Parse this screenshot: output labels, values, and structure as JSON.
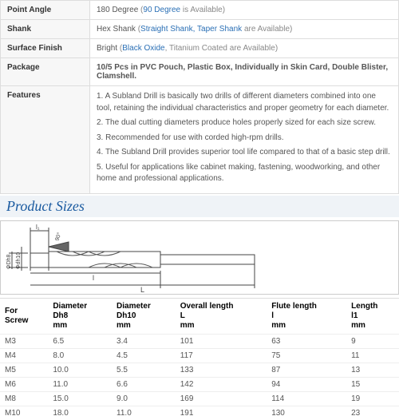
{
  "specs": {
    "pointAngle": {
      "label": "Point Angle",
      "value": "180 Degree",
      "link": "90 Degree",
      "suffix": " is Available"
    },
    "shank": {
      "label": "Shank",
      "value": "Hex Shank",
      "link": "Straight Shank, Taper Shank",
      "suffix": " are Available"
    },
    "surfaceFinish": {
      "label": "Surface Finish",
      "value": "Bright",
      "link": "Black Oxide",
      "suffix": ", Titanium Coated are Available"
    },
    "package": {
      "label": "Package",
      "value": "10/5 Pcs in PVC Pouch, Plastic Box, Individually in Skin Card, Double Blister, Clamshell."
    },
    "features": {
      "label": "Features",
      "lines": [
        "1. A Subland Drill is basically two drills of different diameters combined into one tool, retaining the individual characteristics and proper geometry for each diameter.",
        "2. The dual cutting diameters produce holes properly sized for each size screw.",
        "3. Recommended for use with corded high-rpm drills.",
        "4. The Subland Drill provides superior tool life compared to that of a basic step drill.",
        "5. Useful for applications like cabinet making, fastening, woodworking, and other home and professional applications."
      ]
    }
  },
  "sectionTitle": "Product Sizes",
  "diagram": {
    "l1": "l₁",
    "angle": "90°",
    "Dh8": "ΦDh8",
    "Dh10": "Φdh10",
    "l": "l",
    "L": "L"
  },
  "sizeHeaders": {
    "forScrew": {
      "t": "For",
      "s": "Screw"
    },
    "dh8": {
      "t": "Diameter",
      "s": "Dh8",
      "u": "mm"
    },
    "dh10": {
      "t": "Diameter",
      "s": "Dh10",
      "u": "mm"
    },
    "L": {
      "t": "Overall length",
      "s": "L",
      "u": "mm"
    },
    "l": {
      "t": "Flute length",
      "s": "l",
      "u": "mm"
    },
    "l1": {
      "t": "Length",
      "s": "l1",
      "u": "mm"
    }
  },
  "rows": [
    {
      "s": "M3",
      "dh8": "6.5",
      "dh10": "3.4",
      "L": "101",
      "l": "63",
      "l1": "9"
    },
    {
      "s": "M4",
      "dh8": "8.0",
      "dh10": "4.5",
      "L": "117",
      "l": "75",
      "l1": "11"
    },
    {
      "s": "M5",
      "dh8": "10.0",
      "dh10": "5.5",
      "L": "133",
      "l": "87",
      "l1": "13"
    },
    {
      "s": "M6",
      "dh8": "11.0",
      "dh10": "6.6",
      "L": "142",
      "l": "94",
      "l1": "15"
    },
    {
      "s": "M8",
      "dh8": "15.0",
      "dh10": "9.0",
      "L": "169",
      "l": "114",
      "l1": "19"
    },
    {
      "s": "M10",
      "dh8": "18.0",
      "dh10": "11.0",
      "L": "191",
      "l": "130",
      "l1": "23"
    }
  ],
  "chart_data": {
    "type": "table",
    "title": "Product Sizes",
    "columns": [
      "For Screw",
      "Diameter Dh8 (mm)",
      "Diameter Dh10 (mm)",
      "Overall length L (mm)",
      "Flute length l (mm)",
      "Length l1 (mm)"
    ],
    "rows": [
      [
        "M3",
        6.5,
        3.4,
        101,
        63,
        9
      ],
      [
        "M4",
        8.0,
        4.5,
        117,
        75,
        11
      ],
      [
        "M5",
        10.0,
        5.5,
        133,
        87,
        13
      ],
      [
        "M6",
        11.0,
        6.6,
        142,
        94,
        15
      ],
      [
        "M8",
        15.0,
        9.0,
        169,
        114,
        19
      ],
      [
        "M10",
        18.0,
        11.0,
        191,
        130,
        23
      ]
    ]
  }
}
